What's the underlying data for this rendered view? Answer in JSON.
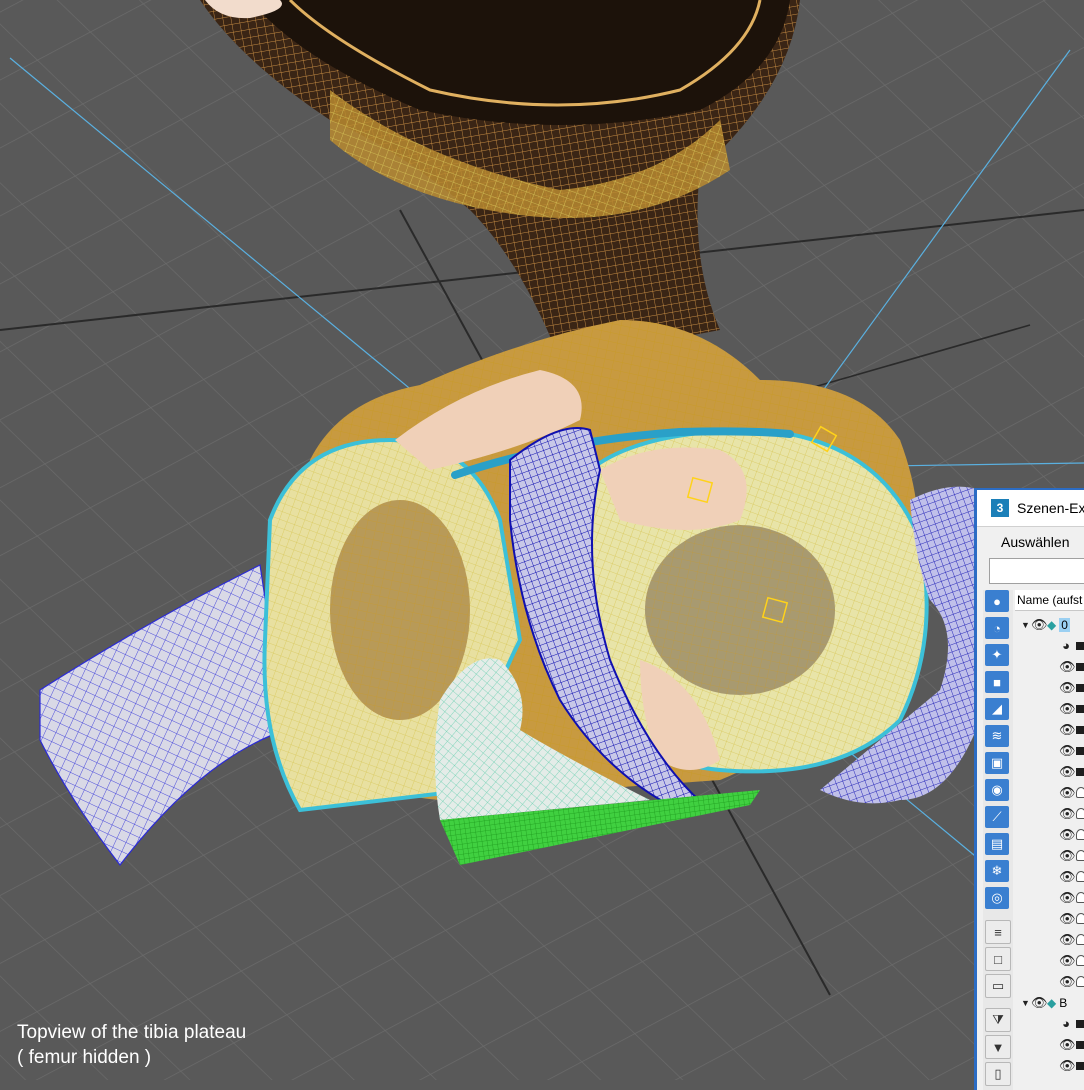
{
  "viewport": {
    "caption_line1": "Topview of the tibia plateau",
    "caption_line2": "( femur hidden )"
  },
  "scene_explorer": {
    "title": "Szenen-Exp",
    "menu_select": "Auswählen",
    "column_header": "Name (aufst",
    "rows": [
      {
        "type": "layer",
        "expanded": true,
        "label": "0"
      },
      {
        "type": "shape"
      },
      {
        "type": "object"
      },
      {
        "type": "object"
      },
      {
        "type": "object"
      },
      {
        "type": "object"
      },
      {
        "type": "object"
      },
      {
        "type": "object"
      },
      {
        "type": "light"
      },
      {
        "type": "light"
      },
      {
        "type": "light"
      },
      {
        "type": "light"
      },
      {
        "type": "light"
      },
      {
        "type": "light"
      },
      {
        "type": "light"
      },
      {
        "type": "light"
      },
      {
        "type": "light"
      },
      {
        "type": "light"
      },
      {
        "type": "layer",
        "expanded": true,
        "label": "B"
      },
      {
        "type": "shape"
      },
      {
        "type": "object"
      },
      {
        "type": "object"
      }
    ],
    "toolbar_icons": [
      "geometry-icon",
      "shapes-icon",
      "lights-icon",
      "cameras-icon",
      "helpers-icon",
      "spacewarps-icon",
      "groups-icon",
      "xrefs-icon",
      "bones-icon",
      "containers-icon",
      "frozen-icon",
      "hidden-icon",
      "list-icon",
      "box-icon",
      "page-icon",
      "filter-x-icon",
      "filter-icon",
      "clip-icon"
    ]
  },
  "colors": {
    "background": "#595959",
    "grid": "#6a6a6a",
    "axis": "#2e2e2e",
    "guide_line": "#5ab0e0",
    "bone_wire": "#d9a53a",
    "cartilage_wire": "#3cc0d8",
    "ligament_wire": "#1a1ad0",
    "tendon_green": "#30c030",
    "panel_accent": "#2b6cc4"
  }
}
